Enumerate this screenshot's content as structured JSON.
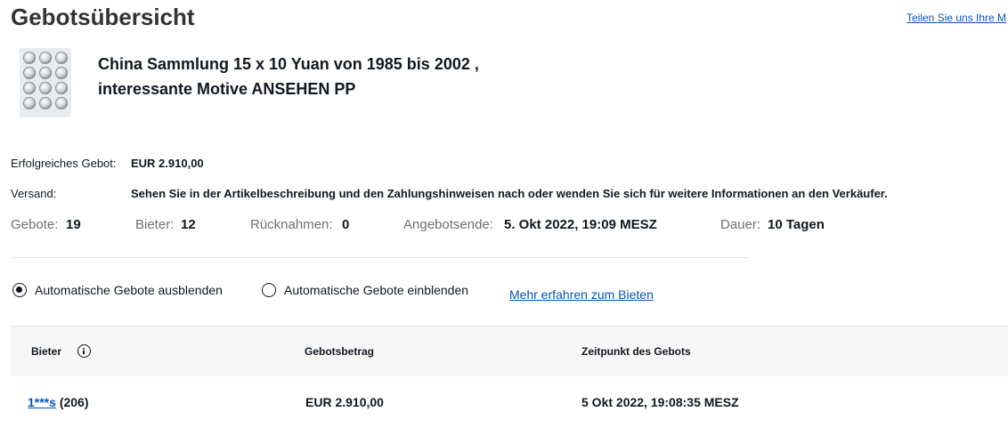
{
  "header": {
    "title": "Gebotsübersicht",
    "share_link": "Teilen Sie uns Ihre M"
  },
  "item": {
    "title_line1": "China Sammlung 15 x 10 Yuan von 1985 bis 2002 ,",
    "title_line2": "interessante Motive ANSEHEN PP"
  },
  "details": {
    "winning_bid_label": "Erfolgreiches Gebot:",
    "winning_bid_value": "EUR 2.910,00",
    "shipping_label": "Versand:",
    "shipping_value": "Sehen Sie in der Artikelbeschreibung und den Zahlungshinweisen nach oder wenden Sie sich für weitere Informationen an den Verkäufer."
  },
  "stats": {
    "bids_label": "Gebote:",
    "bids_value": "19",
    "bidders_label": "Bieter:",
    "bidders_value": "12",
    "retractions_label": "Rücknahmen:",
    "retractions_value": "0",
    "end_label": "Angebotsende:",
    "end_value": "5. Okt 2022, 19:09 MESZ",
    "duration_label": "Dauer:",
    "duration_value": "10 Tagen"
  },
  "options": {
    "hide_auto": "Automatische Gebote ausblenden",
    "show_auto": "Automatische Gebote einblenden",
    "selected": "hide_auto",
    "learn_more": "Mehr erfahren zum Bieten"
  },
  "table": {
    "headers": [
      "Bieter",
      "Gebotsbetrag",
      "Zeitpunkt des Gebots"
    ],
    "rows": [
      {
        "bidder": "1***s",
        "score": "(206)",
        "amount": "EUR 2.910,00",
        "time": "5 Okt 2022, 19:08:35 MESZ"
      }
    ]
  },
  "colors": {
    "link": "#0654ba",
    "text": "#111820",
    "muted": "#707070",
    "header_bg": "#f7f7f7"
  }
}
